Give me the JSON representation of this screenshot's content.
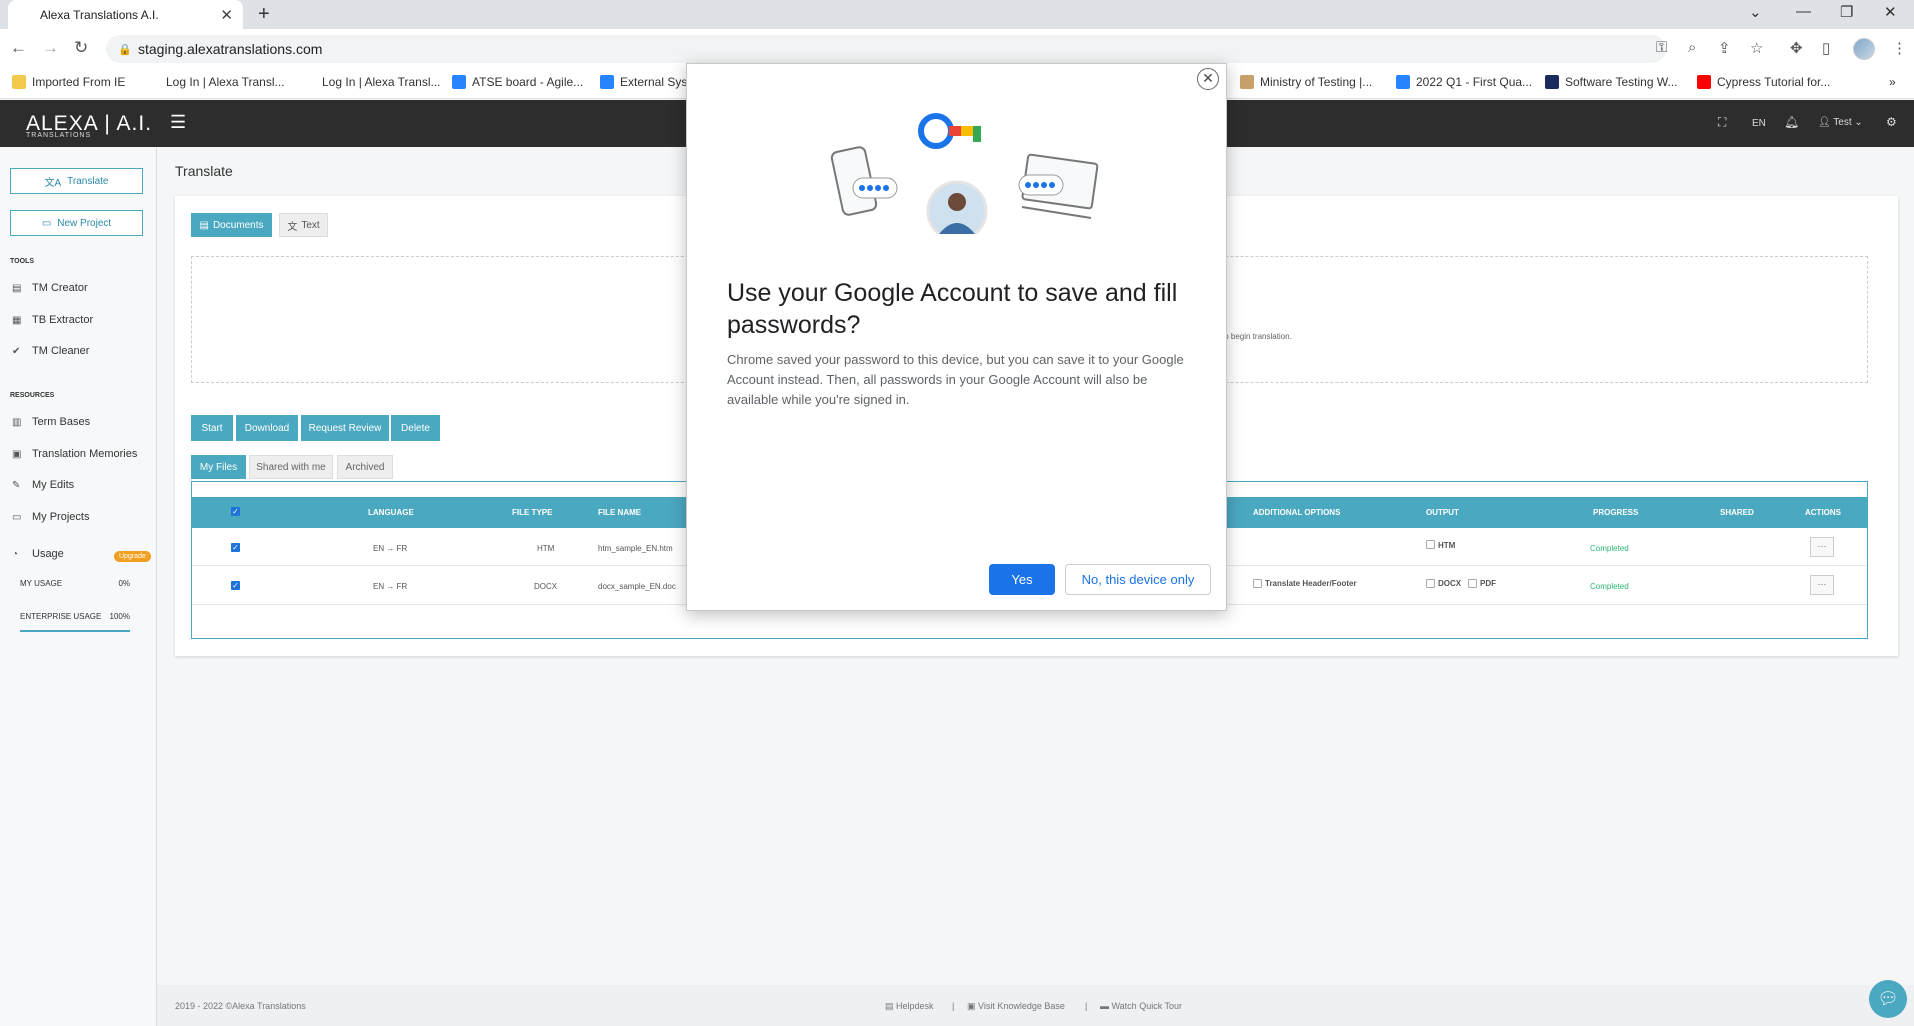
{
  "browser": {
    "tab_title": "Alexa Translations A.I.",
    "url": "staging.alexatranslations.com",
    "bookmarks": [
      {
        "label": "Imported From IE",
        "icon": "folder-icon"
      },
      {
        "label": "Log In | Alexa Transl...",
        "icon": "page-icon"
      },
      {
        "label": "Log In | Alexa Transl...",
        "icon": "page-icon"
      },
      {
        "label": "ATSE board - Agile...",
        "icon": "jira-icon"
      },
      {
        "label": "External Sys",
        "icon": "jira-icon"
      },
      {
        "label": "Ministry of Testing |...",
        "icon": "mot-icon"
      },
      {
        "label": "2022 Q1 - First Qua...",
        "icon": "jira-icon"
      },
      {
        "label": "Software Testing W...",
        "icon": "s-icon"
      },
      {
        "label": "Cypress Tutorial for...",
        "icon": "youtube-icon"
      }
    ]
  },
  "app": {
    "logo_main": "ALEXA | A.I.",
    "logo_sub": "TRANSLATIONS",
    "lang": "EN",
    "user": "Test"
  },
  "sidebar": {
    "translate_btn": "Translate",
    "new_project_btn": "New Project",
    "tools_head": "TOOLS",
    "tools": [
      "TM Creator",
      "TB Extractor",
      "TM Cleaner"
    ],
    "resources_head": "RESOURCES",
    "resources": [
      "Term Bases",
      "Translation Memories",
      "My Edits",
      "My Projects"
    ],
    "usage_label": "Usage",
    "upgrade": "Upgrade",
    "my_usage_label": "MY USAGE",
    "my_usage_value": "0%",
    "enterprise_label": "ENTERPRISE USAGE",
    "enterprise_value": "100%"
  },
  "main": {
    "title": "Translate",
    "tabs": [
      "Documents",
      "Text"
    ],
    "dropzone_text": "to begin translation.",
    "actions": [
      "Start",
      "Download",
      "Request Review",
      "Delete"
    ],
    "file_tabs": [
      "My Files",
      "Shared with me",
      "Archived"
    ],
    "columns": [
      "LANGUAGE",
      "FILE TYPE",
      "FILE NAME",
      "ADDITIONAL OPTIONS",
      "OUTPUT",
      "PROGRESS",
      "SHARED",
      "ACTIONS"
    ],
    "rows": [
      {
        "language": "EN → FR",
        "file_type": "HTM",
        "file_name": "htm_sample_EN.htm",
        "additional": "",
        "output": [
          "HTM"
        ],
        "progress": "Completed",
        "action": "···"
      },
      {
        "language": "EN → FR",
        "file_type": "DOCX",
        "file_name": "docx_sample_EN.doc",
        "additional": "Translate Header/Footer",
        "output": [
          "DOCX",
          "PDF"
        ],
        "progress": "Completed",
        "action": "···"
      }
    ]
  },
  "footer": {
    "copyright": "2019 - 2022 ©Alexa Translations",
    "links": [
      "Helpdesk",
      "Visit Knowledge Base",
      "Watch Quick Tour"
    ],
    "separator": "|"
  },
  "dialog": {
    "title": "Use your Google Account to save and fill passwords?",
    "body": "Chrome saved your password to this device, but you can save it to your Google Account instead. Then, all passwords in your Google Account will also be available while you're signed in.",
    "yes": "Yes",
    "no": "No, this device only",
    "close": "✕"
  },
  "colors": {
    "accent": "#4aa8c0",
    "google_blue": "#1a73e8",
    "completed": "#2bb673"
  }
}
